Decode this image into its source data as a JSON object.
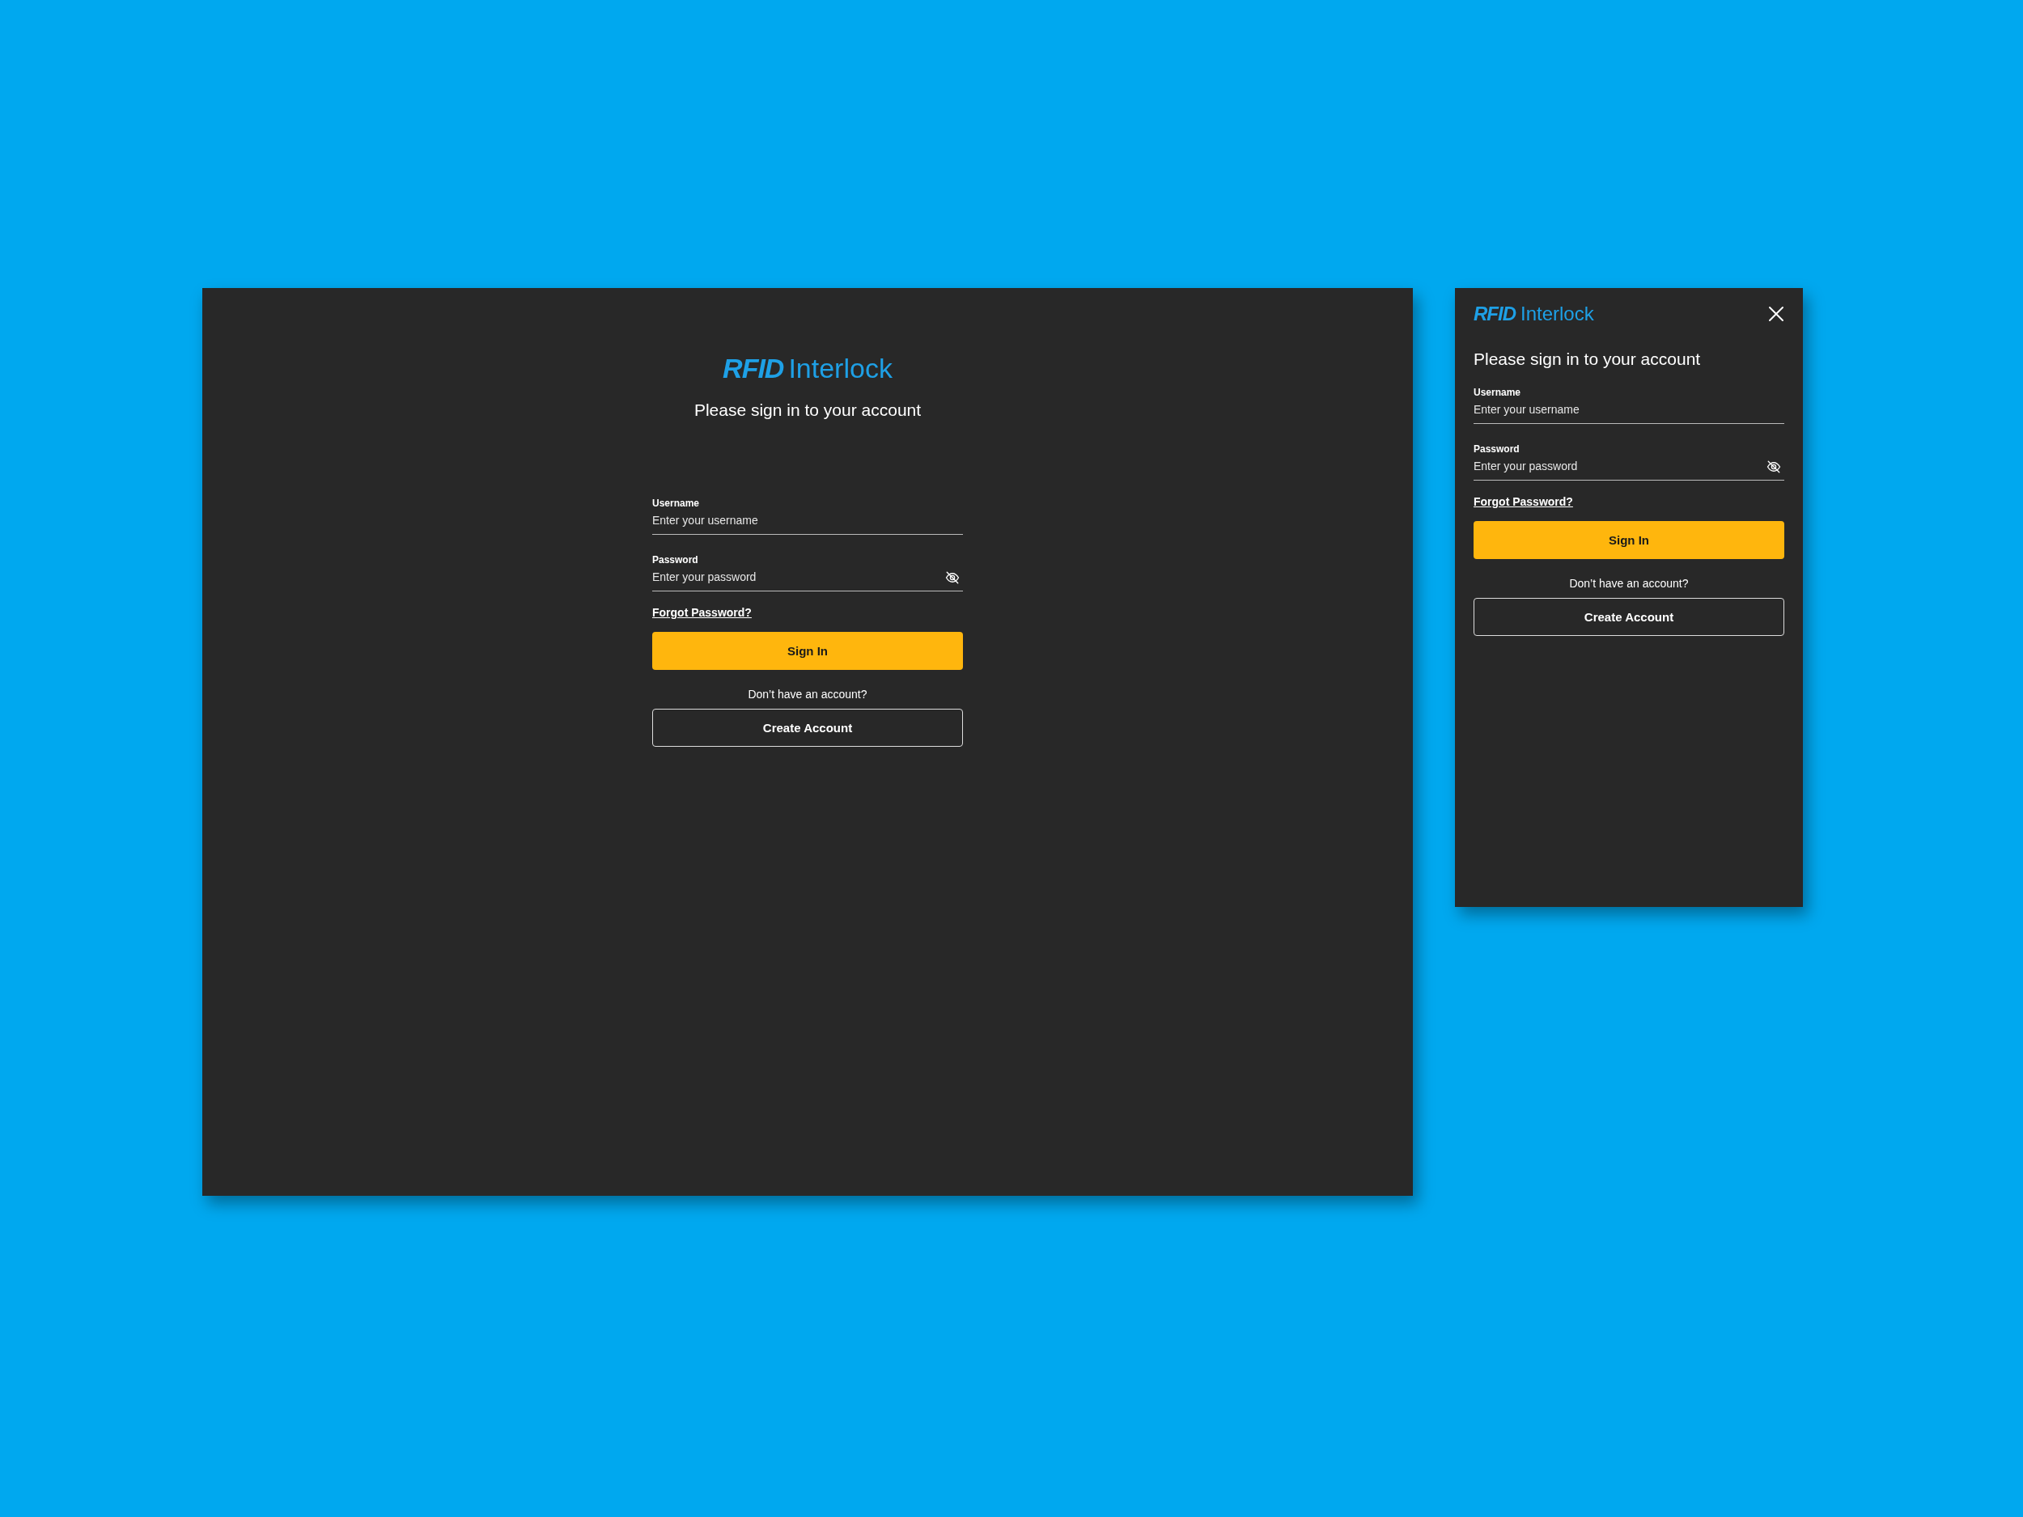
{
  "screens": [
    {
      "kind": "desktop",
      "logo": {
        "mark": "RFID",
        "name": "Interlock"
      },
      "subtitle": "Please sign in to your account",
      "fields": [
        {
          "kind": "text",
          "label": "Username",
          "placeholder": "Enter your username"
        },
        {
          "kind": "password",
          "label": "Password",
          "placeholder": "Enter your password"
        }
      ],
      "forgot_link": "Forgot Password?",
      "sign_in_button": "Sign In",
      "prompt": "Don’t have an account?",
      "create_account_button": "Create Account"
    },
    {
      "kind": "mobile",
      "logo": {
        "mark": "RFID",
        "name": "Interlock"
      },
      "subtitle": "Please sign in to your account",
      "fields": [
        {
          "kind": "text",
          "label": "Username",
          "placeholder": "Enter your username"
        },
        {
          "kind": "password",
          "label": "Password",
          "placeholder": "Enter your password"
        }
      ],
      "forgot_link": "Forgot Password?",
      "sign_in_button": "Sign In",
      "prompt": "Don’t have an account?",
      "create_account_button": "Create Account"
    }
  ]
}
